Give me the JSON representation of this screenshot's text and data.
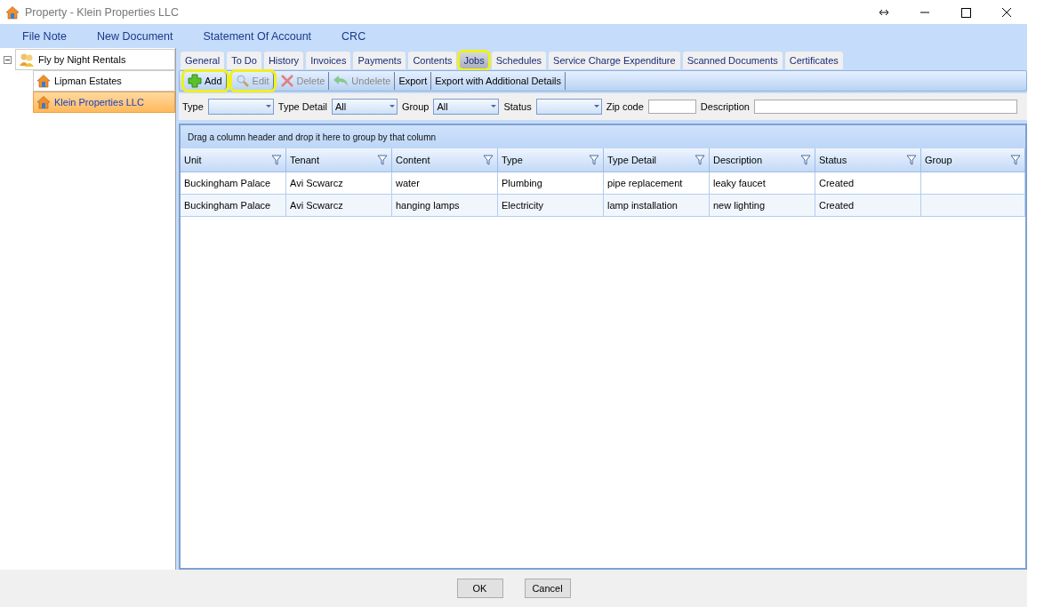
{
  "window": {
    "title": "Property - Klein Properties LLC"
  },
  "menu": [
    "File Note",
    "New Document",
    "Statement Of Account",
    "CRC"
  ],
  "tree": {
    "label": "Fly by Night Rentals",
    "expanded": true,
    "selected": false,
    "children": [
      {
        "label": "Lipman Estates",
        "selected": false
      },
      {
        "label": "Klein Properties LLC",
        "selected": true
      }
    ]
  },
  "tabs": [
    {
      "label": "General",
      "selected": false,
      "highlighted": false
    },
    {
      "label": "To Do",
      "selected": false,
      "highlighted": false
    },
    {
      "label": "History",
      "selected": false,
      "highlighted": false
    },
    {
      "label": "Invoices",
      "selected": false,
      "highlighted": false
    },
    {
      "label": "Payments",
      "selected": false,
      "highlighted": false
    },
    {
      "label": "Contents",
      "selected": false,
      "highlighted": false
    },
    {
      "label": "Jobs",
      "selected": true,
      "highlighted": true
    },
    {
      "label": "Schedules",
      "selected": false,
      "highlighted": false
    },
    {
      "label": "Service Charge Expenditure",
      "selected": false,
      "highlighted": false
    },
    {
      "label": "Scanned Documents",
      "selected": false,
      "highlighted": false
    },
    {
      "label": "Certificates",
      "selected": false,
      "highlighted": false
    }
  ],
  "toolbar": [
    {
      "label": "Add",
      "kind": "plus",
      "disabled": false,
      "highlighted": true
    },
    {
      "label": "Edit",
      "kind": "search",
      "disabled": true,
      "highlighted": true
    },
    {
      "label": "Delete",
      "kind": "cross",
      "disabled": true,
      "highlighted": false
    },
    {
      "label": "Undelete",
      "kind": "undo",
      "disabled": true,
      "highlighted": false
    },
    {
      "label": "Export",
      "kind": "text",
      "disabled": false,
      "highlighted": false
    },
    {
      "label": "Export with Additional Details",
      "kind": "text",
      "disabled": false,
      "highlighted": false
    }
  ],
  "filters": [
    {
      "kind": "select",
      "label": "Type"
    },
    {
      "kind": "select",
      "label": "Type Detail",
      "value": "All"
    },
    {
      "kind": "select",
      "label": "Group",
      "value": "All"
    },
    {
      "kind": "select",
      "label": "Status"
    },
    {
      "kind": "text",
      "label": "Zip code"
    },
    {
      "kind": "wide",
      "label": "Description"
    }
  ],
  "group_panel": "Drag a column header and drop it here to group by that column",
  "table": {
    "columns": [
      "Unit",
      "Tenant",
      "Content",
      "Type",
      "Type Detail",
      "Description",
      "Status",
      "Group"
    ],
    "rows": [
      [
        "Buckingham Palace",
        "Avi Scwarcz",
        "water",
        "Plumbing",
        "pipe replacement",
        "leaky faucet",
        "Created",
        null
      ],
      [
        "Buckingham Palace",
        "Avi Scwarcz",
        "hanging lamps",
        "Electricity",
        "lamp installation",
        "new lighting",
        "Created",
        null
      ]
    ]
  },
  "buttons": [
    "OK",
    "Cancel"
  ]
}
